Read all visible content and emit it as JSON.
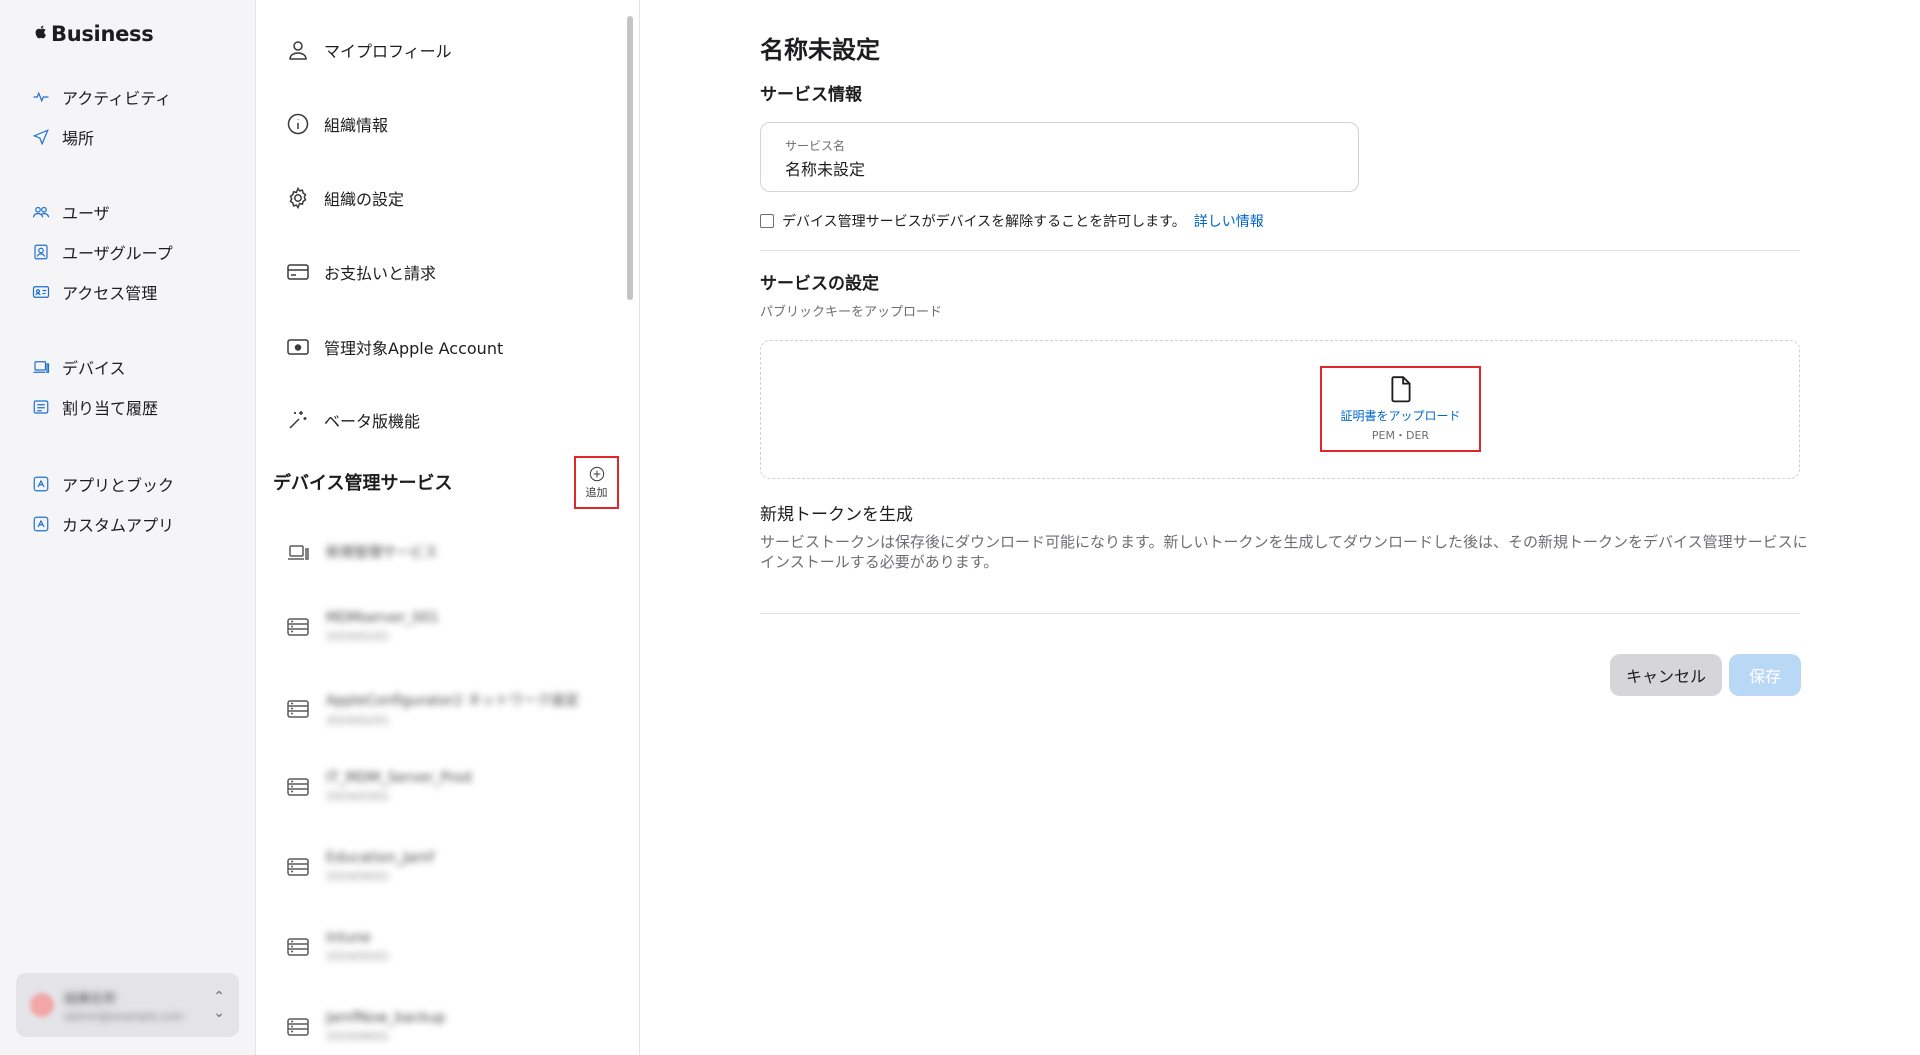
{
  "brand": {
    "logo": "",
    "name": "Business"
  },
  "nav": {
    "items": [
      {
        "label": "アクティビティ",
        "icon": "activity-icon"
      },
      {
        "label": "場所",
        "icon": "location-icon"
      },
      {
        "label": "ユーザ",
        "icon": "users-icon"
      },
      {
        "label": "ユーザグループ",
        "icon": "user-group-icon"
      },
      {
        "label": "アクセス管理",
        "icon": "access-icon"
      },
      {
        "label": "デバイス",
        "icon": "device-icon"
      },
      {
        "label": "割り当て履歴",
        "icon": "history-icon"
      },
      {
        "label": "アプリとブック",
        "icon": "apps-icon"
      },
      {
        "label": "カスタムアプリ",
        "icon": "custom-app-icon"
      }
    ],
    "account": {
      "name": "組織名称",
      "detail": "admin@example.com"
    }
  },
  "settings_menu": {
    "items": [
      {
        "label": "マイプロフィール",
        "icon": "person-icon"
      },
      {
        "label": "組織情報",
        "icon": "info-icon"
      },
      {
        "label": "組織の設定",
        "icon": "gear-icon"
      },
      {
        "label": "お支払いと請求",
        "icon": "card-icon"
      },
      {
        "label": "管理対象Apple Account",
        "icon": "apple-account-icon"
      },
      {
        "label": "ベータ版機能",
        "icon": "sparkle-icon"
      }
    ],
    "section_title": "デバイス管理サービス",
    "add_label": "追加",
    "services": [
      {
        "name": "新規管理サービス",
        "detail": ""
      },
      {
        "name": "MDMserver_001",
        "detail": "2024/01/01"
      },
      {
        "name": "AppleConfigurator2 ネットワーク設定",
        "detail": "2024/02/01"
      },
      {
        "name": "IT_MDM_Server_Prod",
        "detail": "2024/03/01"
      },
      {
        "name": "Education_Jamf",
        "detail": "2024/04/01"
      },
      {
        "name": "Intune",
        "detail": "2024/05/01"
      },
      {
        "name": "JamfNow_backup",
        "detail": "2024/06/01"
      }
    ]
  },
  "main": {
    "title": "名称未設定",
    "service_info_heading": "サービス情報",
    "service_name_label": "サービス名",
    "service_name_value": "名称未設定",
    "release_checkbox_label": "デバイス管理サービスがデバイスを解除することを許可します。",
    "learn_more": "詳しい情報",
    "service_settings_heading": "サービスの設定",
    "upload_public_key": "パブリックキーをアップロード",
    "upload_cert_label": "証明書をアップロード",
    "upload_formats": "PEM・DER",
    "new_token_heading": "新規トークンを生成",
    "new_token_desc": "サービストークンは保存後にダウンロード可能になります。新しいトークンを生成してダウンロードした後は、その新規トークンをデバイス管理サービスにインストールする必要があります。",
    "cancel_label": "キャンセル",
    "save_label": "保存"
  }
}
